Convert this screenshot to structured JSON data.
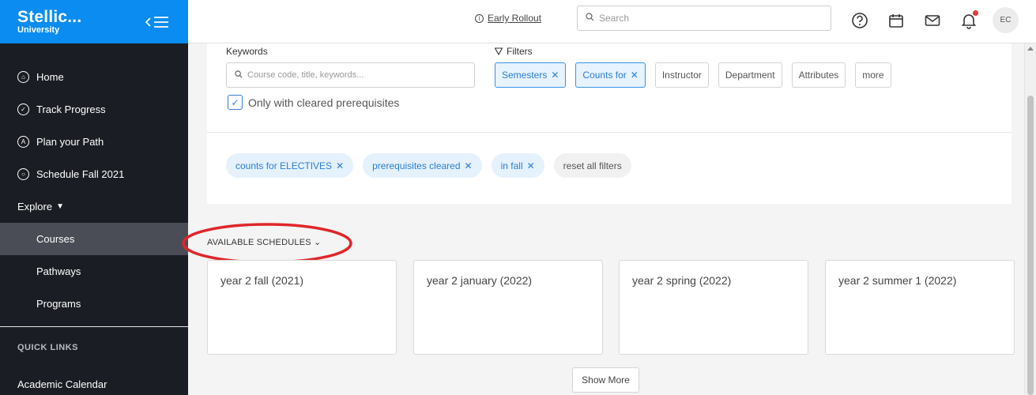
{
  "brand": {
    "name": "Stellic...",
    "subtitle": "University"
  },
  "sidebar": {
    "items": [
      {
        "icon": "home-icon",
        "glyph": "⌂",
        "label": "Home"
      },
      {
        "icon": "check-circle-icon",
        "glyph": "✓",
        "label": "Track Progress"
      },
      {
        "icon": "plan-icon",
        "glyph": "A",
        "label": "Plan your Path"
      },
      {
        "icon": "schedule-icon",
        "glyph": "○",
        "label": "Schedule Fall 2021"
      }
    ],
    "explore": {
      "label": "Explore",
      "caret": "▼"
    },
    "sub_items": [
      {
        "label": "Courses",
        "active": true
      },
      {
        "label": "Pathways",
        "active": false
      },
      {
        "label": "Programs",
        "active": false
      }
    ],
    "quick_links_title": "QUICK LINKS",
    "quick_links": [
      "Academic Calendar"
    ]
  },
  "topbar": {
    "rollout_label": "Early Rollout",
    "search_placeholder": "Search",
    "avatar_initials": "EC"
  },
  "filters": {
    "keywords_label": "Keywords",
    "keywords_placeholder": "Course code, title, keywords...",
    "prereq_label": "Only with cleared prerequisites",
    "prereq_checked": true,
    "filters_label": "Filters",
    "buttons": [
      {
        "label": "Semesters",
        "selected": true
      },
      {
        "label": "Counts for",
        "selected": true
      },
      {
        "label": "Instructor",
        "selected": false
      },
      {
        "label": "Department",
        "selected": false
      },
      {
        "label": "Attributes",
        "selected": false
      },
      {
        "label": "more",
        "selected": false
      }
    ],
    "active_chips": [
      "counts for ELECTIVES",
      "prerequisites cleared",
      "in fall"
    ],
    "reset_label": "reset all filters"
  },
  "schedules": {
    "title": "AVAILABLE SCHEDULES",
    "cards": [
      "year 2 fall (2021)",
      "year 2 january (2022)",
      "year 2 spring (2022)",
      "year 2 summer 1 (2022)"
    ],
    "show_more_label": "Show More"
  },
  "colors": {
    "brand": "#0a8cf0",
    "sidebar": "#1b1d24",
    "annotation": "#e0262b",
    "accent": "#2a7fd3"
  }
}
